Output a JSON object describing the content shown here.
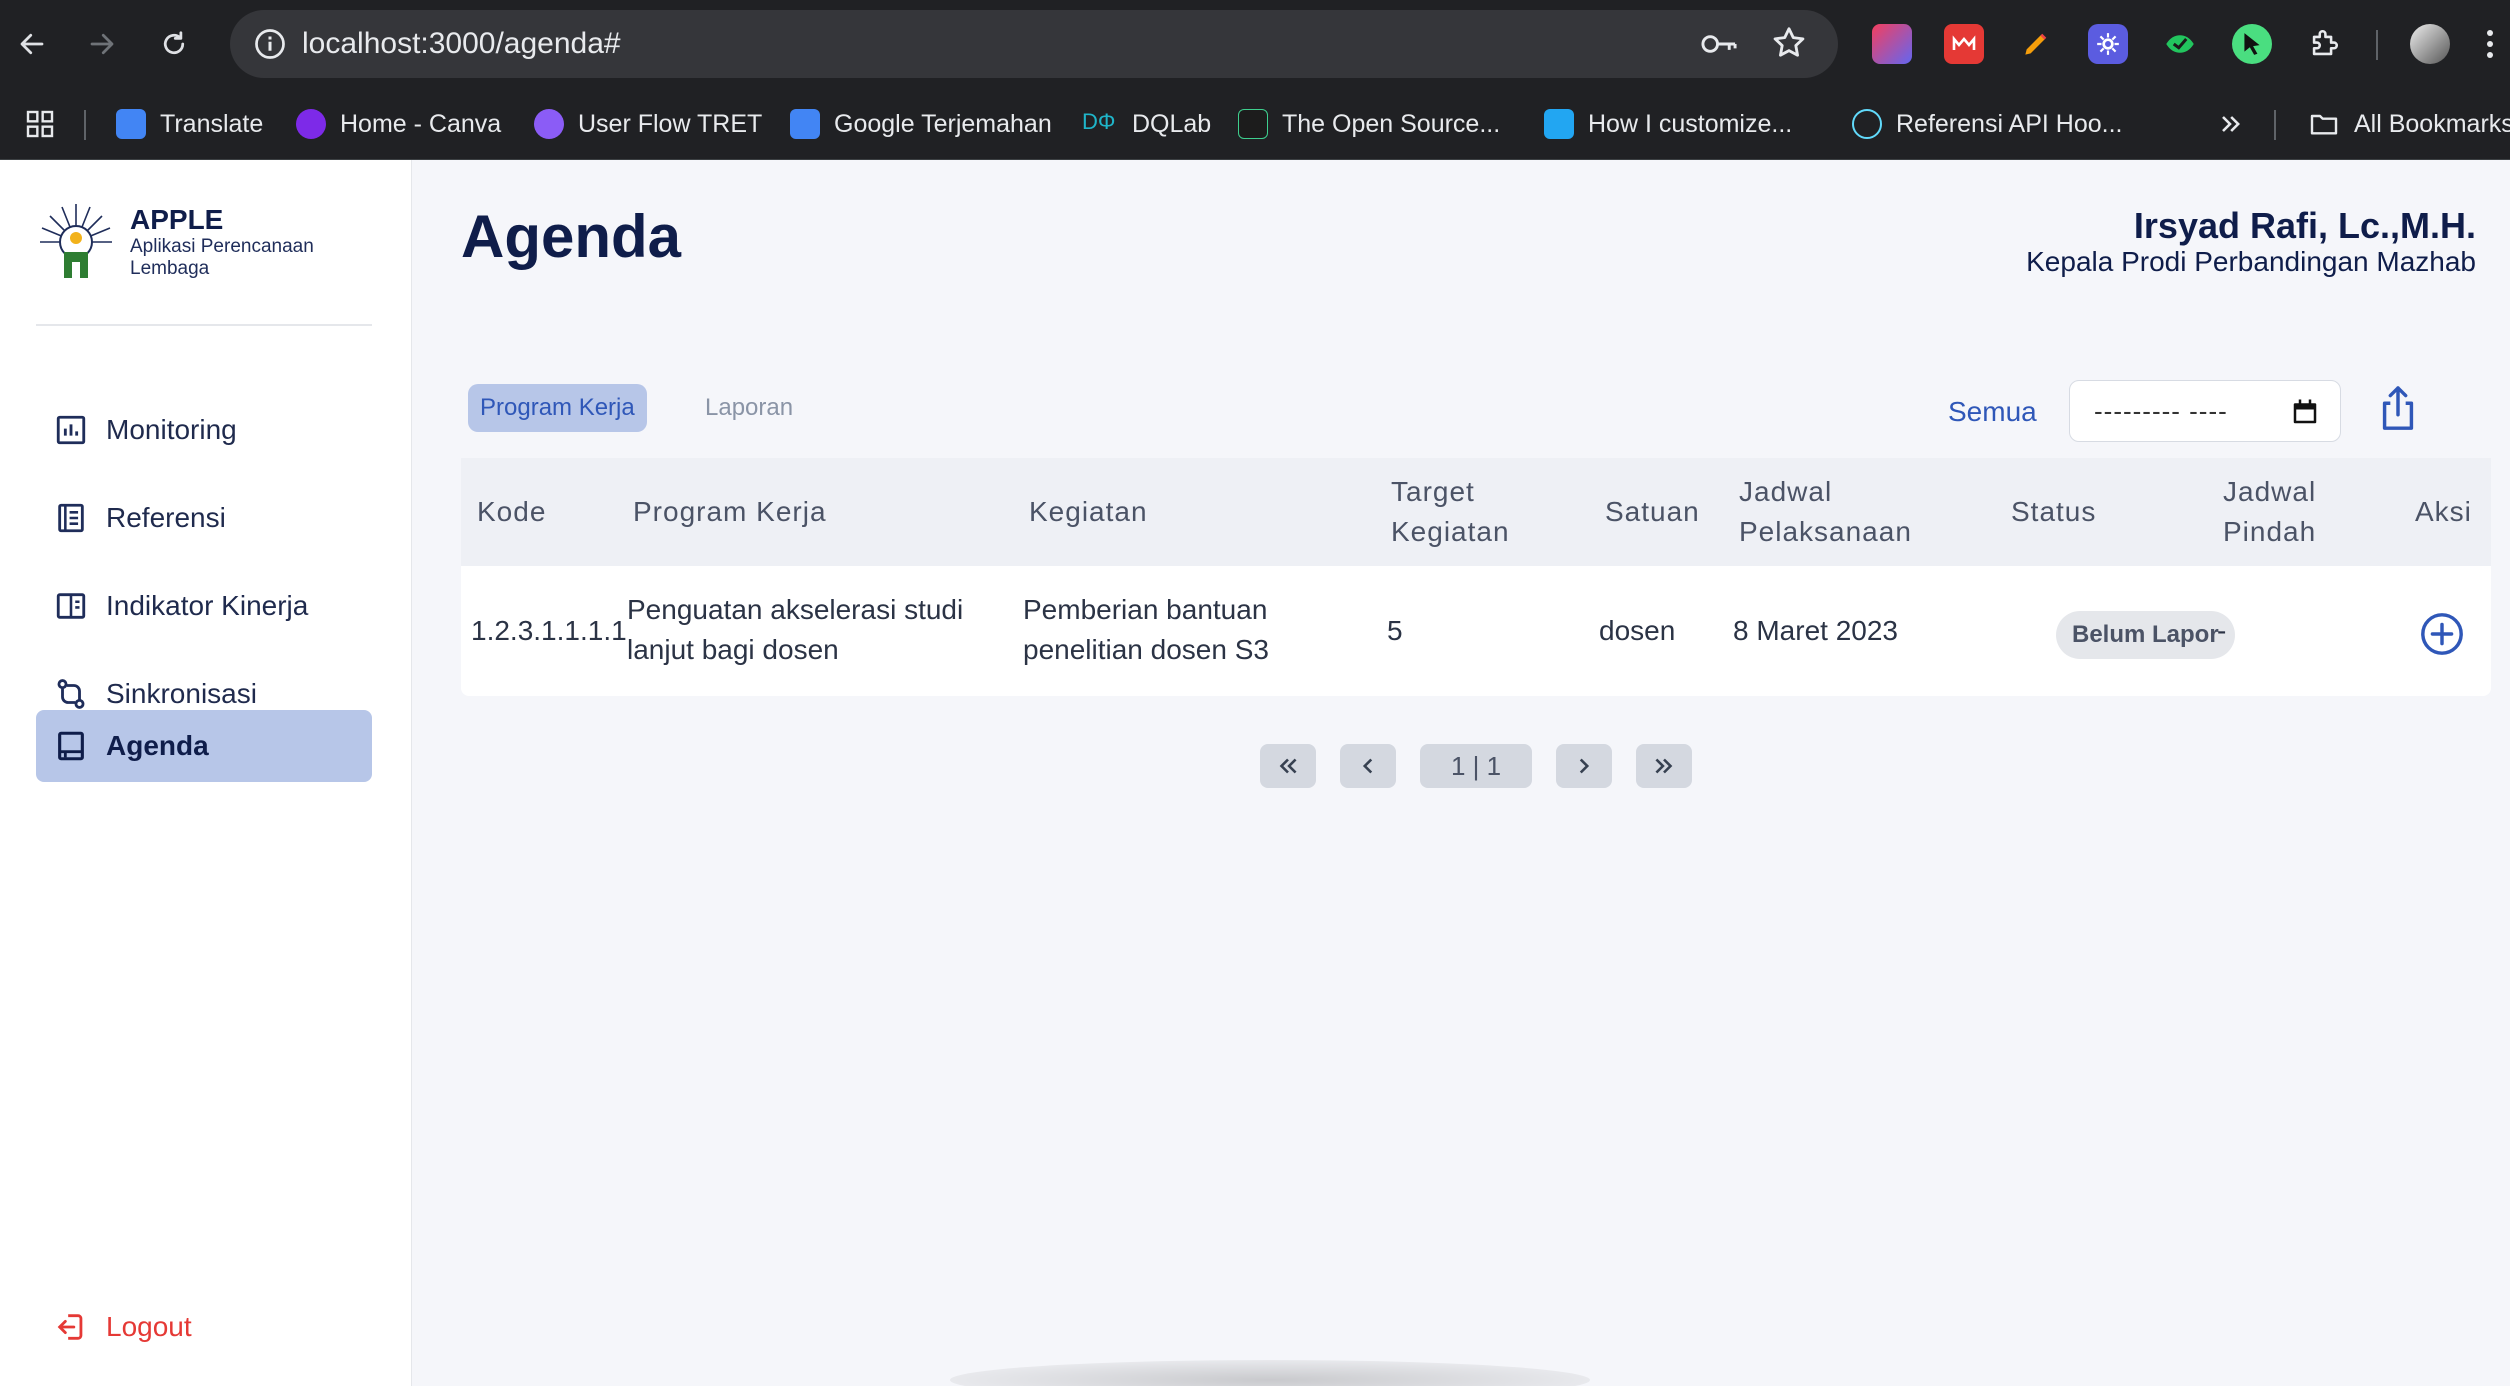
{
  "browser": {
    "url": "localhost:3000/agenda#",
    "bookmarks": [
      {
        "label": "Translate",
        "color": "#4285f4"
      },
      {
        "label": "Home - Canva",
        "color": "#7d2ae8"
      },
      {
        "label": "User Flow TRET",
        "color": "#8b5cf6"
      },
      {
        "label": "Google Terjemahan",
        "color": "#4285f4"
      },
      {
        "label": "DQLab",
        "color": "#1fb5c9"
      },
      {
        "label": "The Open Source...",
        "color": "#3ecf8e"
      },
      {
        "label": "How I customize...",
        "color": "#22a6f2"
      },
      {
        "label": "Referensi API Hoo...",
        "color": "#61dafb"
      }
    ],
    "all_bookmarks": "All Bookmarks"
  },
  "app": {
    "name": "APPLE",
    "subtitle": "Aplikasi Perencanaan Lembaga"
  },
  "sidebar": {
    "items": [
      {
        "label": "Monitoring",
        "icon": "chart-icon"
      },
      {
        "label": "Referensi",
        "icon": "book-icon"
      },
      {
        "label": "Indikator Kinerja",
        "icon": "panel-icon"
      },
      {
        "label": "Sinkronisasi",
        "icon": "sync-icon"
      },
      {
        "label": "Agenda",
        "icon": "agenda-icon",
        "active": true
      }
    ],
    "logout": "Logout"
  },
  "header": {
    "title": "Agenda",
    "user_name": "Irsyad Rafi, Lc.,M.H.",
    "user_role": "Kepala Prodi Perbandingan Mazhab"
  },
  "tabs": [
    {
      "label": "Program Kerja",
      "active": true
    },
    {
      "label": "Laporan",
      "active": false
    }
  ],
  "filter": {
    "label": "Semua",
    "date_placeholder": "--------- ----"
  },
  "table": {
    "headers": {
      "kode": "Kode",
      "program": "Program Kerja",
      "kegiatan": "Kegiatan",
      "target_1": "Target",
      "target_2": "Kegiatan",
      "satuan": "Satuan",
      "jadwal_1": "Jadwal",
      "jadwal_2": "Pelaksanaan",
      "status": "Status",
      "pindah_1": "Jadwal",
      "pindah_2": "Pindah",
      "aksi": "Aksi"
    },
    "rows": [
      {
        "kode": "1.2.3.1.1.1.1",
        "program_1": "Penguatan akselerasi studi",
        "program_2": "lanjut bagi dosen",
        "kegiatan_1": "Pemberian bantuan",
        "kegiatan_2": "penelitian dosen S3",
        "target": "5",
        "satuan": "dosen",
        "jadwal": "8 Maret 2023",
        "status": "Belum Lapor",
        "pindah": "-"
      }
    ]
  },
  "pagination": {
    "page_label": "1 | 1"
  },
  "colors": {
    "primary": "#2f57b8",
    "navy": "#0f1d4a",
    "active_bg": "#b7c6e8",
    "danger": "#e53935"
  }
}
